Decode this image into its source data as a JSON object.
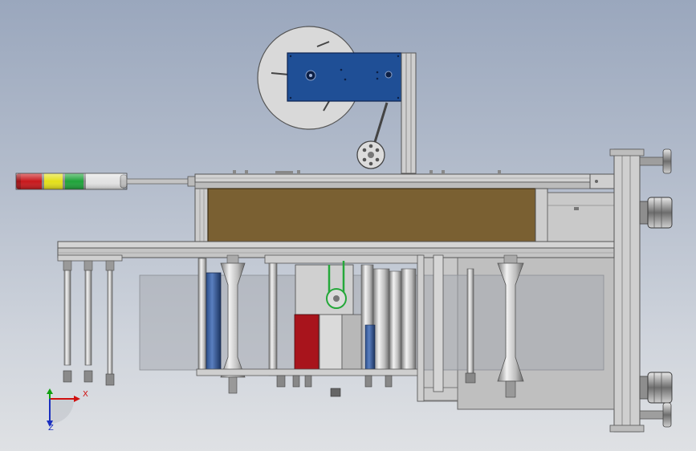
{
  "viewport": {
    "background_top": "#9aa7bd",
    "background_bottom": "#dfe1e4"
  },
  "model": {
    "frame_color": "#c9c9c9",
    "panel_color": "#7a6032",
    "motor_box_color": "#1f4f96",
    "reel_color": "#d9d9d9",
    "film_color": "#a8acb2",
    "signal_tower_colors": [
      "#c8181c",
      "#e4e01a",
      "#1fa33a",
      "#e2e2e2"
    ]
  },
  "triad": {
    "x_label": "X",
    "z_label": "Z",
    "x_color": "#d01010",
    "y_color": "#10a010",
    "z_color": "#1a2fbf",
    "x_icon": "axis-x-arrow-icon",
    "y_icon": "axis-y-arrow-icon",
    "z_icon": "axis-z-arrow-icon"
  }
}
